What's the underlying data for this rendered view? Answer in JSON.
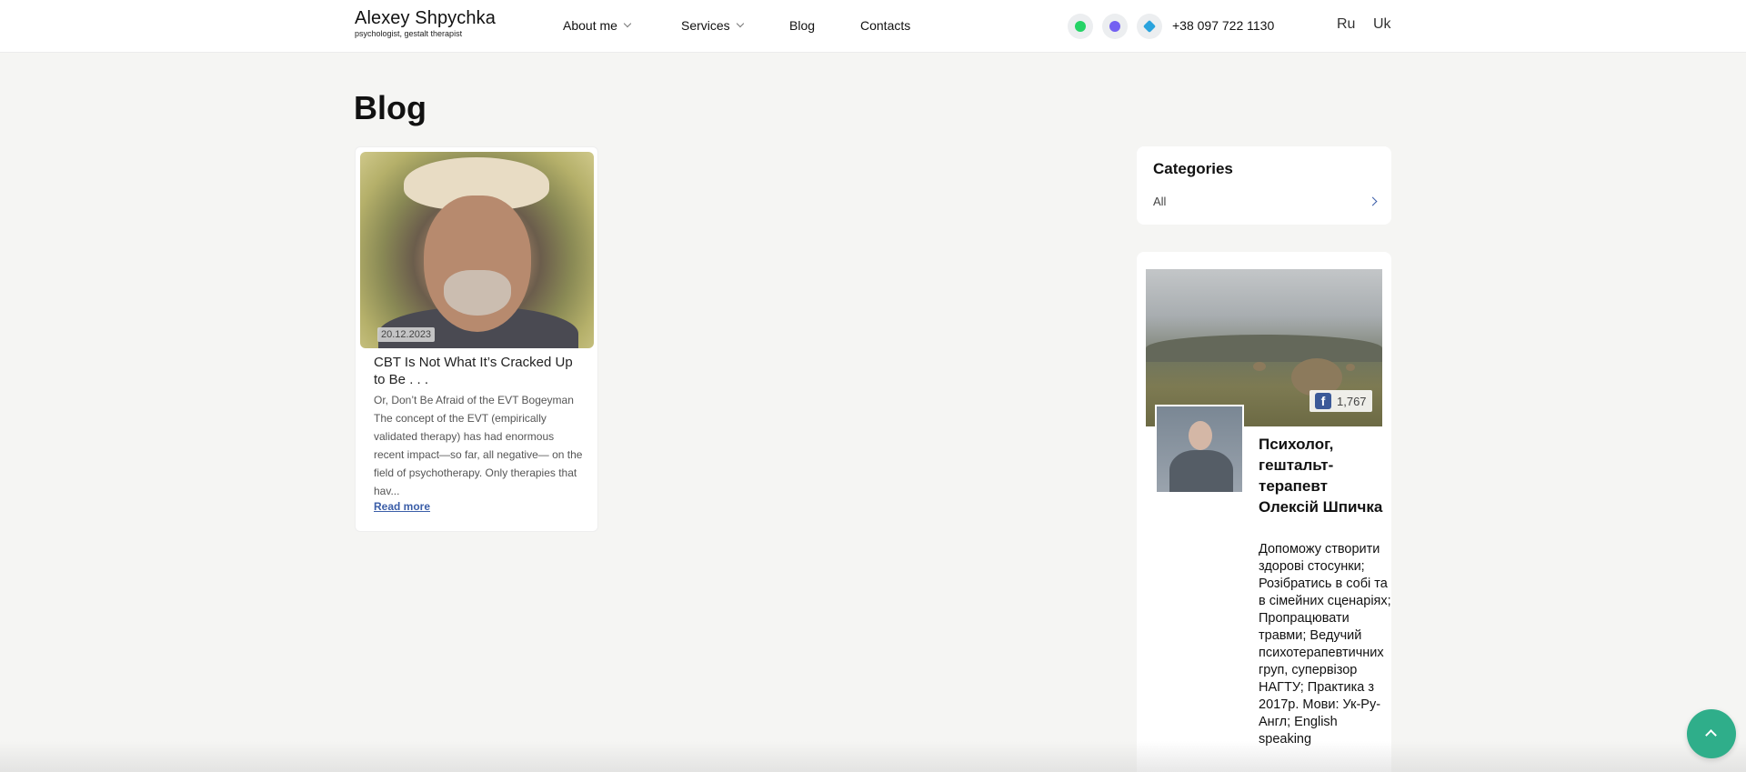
{
  "header": {
    "logo_name": "Alexey Shpychka",
    "logo_tagline": "psychologist, gestalt therapist",
    "nav": [
      {
        "label": "About me",
        "has_dropdown": true
      },
      {
        "label": "Services",
        "has_dropdown": true
      },
      {
        "label": "Blog",
        "has_dropdown": false
      },
      {
        "label": "Contacts",
        "has_dropdown": false
      }
    ],
    "messengers": [
      {
        "icon": "whatsapp-icon",
        "color": "#25d366"
      },
      {
        "icon": "viber-icon",
        "color": "#7360f2"
      },
      {
        "icon": "telegram-icon",
        "color": "#2aa3dd"
      }
    ],
    "phone": "+38 097 722 1130",
    "languages": [
      "Ru",
      "Uk"
    ]
  },
  "page": {
    "title": "Blog"
  },
  "posts": [
    {
      "date": "20.12.2023",
      "title": "CBT Is Not What It’s Cracked Up to Be . . .",
      "excerpt": "Or, Don’t Be Afraid of the EVT Bogeyman The concept of the EVT (empirically validated therapy) has had enormous recent impact—so far, all negative— on the field of psychotherapy. Only therapies that hav...",
      "read_more": "Read more"
    }
  ],
  "sidebar": {
    "categories_title": "Categories",
    "categories": [
      "All"
    ],
    "facebook": {
      "likes": "1,767",
      "page_name": "Психолог, гештальт-терапевт Олексій Шпичка",
      "description": "Допоможу створити здорові стосунки; Розібратись в собі та в сімейних сценаріях; Пропрацювати травми; Ведучий психотерапевтичних груп, супервізор НАГТУ; Практика з 2017р. Мови: Ук-Ру-Англ; English speaking"
    }
  },
  "colors": {
    "accent_green": "#2fae8a",
    "link_blue": "#3b5ea8",
    "facebook_blue": "#3b5998"
  }
}
